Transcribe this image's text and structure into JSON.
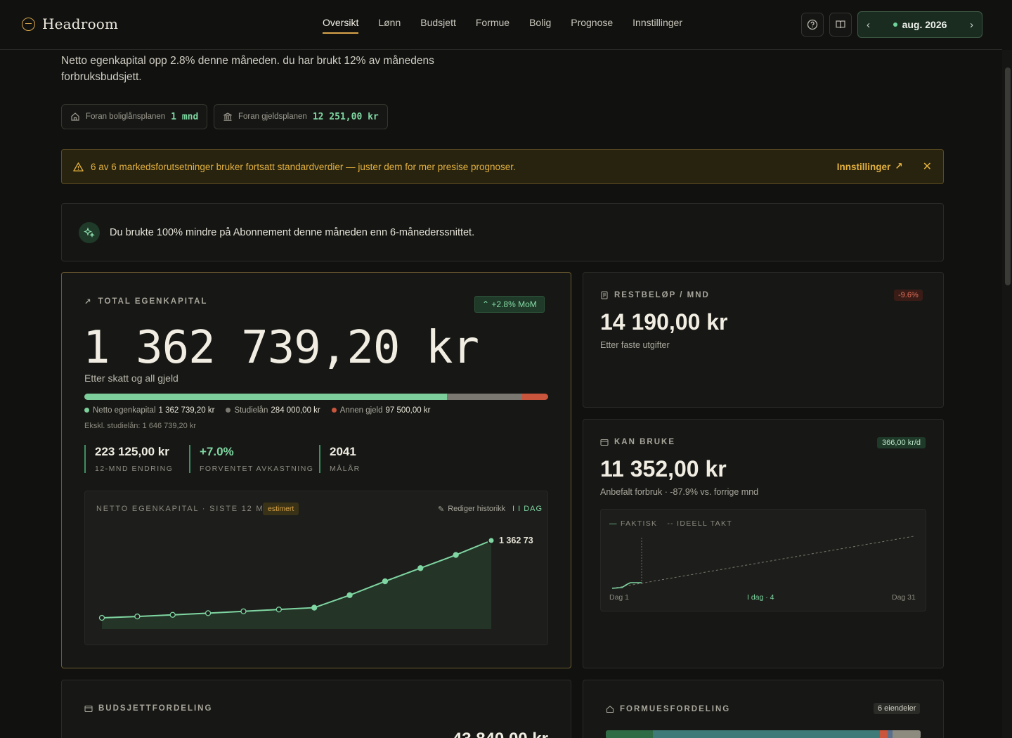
{
  "app": {
    "name": "Headroom"
  },
  "nav": {
    "items": [
      "Oversikt",
      "Lønn",
      "Budsjett",
      "Formue",
      "Bolig",
      "Prognose",
      "Innstillinger"
    ],
    "active": "Oversikt"
  },
  "month_picker": {
    "label": "aug. 2026"
  },
  "summary": {
    "text": "Netto egenkapital opp 2.8% denne måneden. du har brukt 12% av månedens forbruksbudsjett."
  },
  "chips": [
    {
      "label": "Foran boliglånsplanen",
      "value": "1 mnd",
      "icon": "home-icon"
    },
    {
      "label": "Foran gjeldsplanen",
      "value": "12 251,00 kr",
      "icon": "bank-icon"
    }
  ],
  "warning": {
    "message": "6 av 6 markedsforutsetninger bruker fortsatt standardverdier — juster dem for mer presise prognoser.",
    "link": "Innstillinger"
  },
  "insight": {
    "text": "Du brukte 100% mindre på Abonnement denne måneden enn 6-månederssnittet."
  },
  "equity": {
    "label": "TOTAL EGENKAPITAL",
    "badge": "+2.8% MoM",
    "value": "1 362 739,20 kr",
    "sub": "Etter skatt og all gjeld",
    "bar": [
      {
        "name": "Netto egenkapital",
        "value": "1 362 739,20 kr",
        "amount": 1362739.2,
        "color": "#7ccf9a"
      },
      {
        "name": "Studielån",
        "value": "284 000,00 kr",
        "amount": 284000,
        "color": "#7a7870"
      },
      {
        "name": "Annen gjeld",
        "value": "97 500,00 kr",
        "amount": 97500,
        "color": "#c9553d"
      }
    ],
    "excl": "Ekskl. studielån: 1 646 739,20 kr",
    "stats": [
      {
        "value": "223 125,00 kr",
        "label": "12-MND ENDRING"
      },
      {
        "value": "+7.0%",
        "label": "FORVENTET AVKASTNING"
      },
      {
        "value": "2041",
        "label": "MÅLÅR"
      }
    ],
    "chart_panel": {
      "title": "NETTO EGENKAPITAL · SISTE 12 MND",
      "tag": "estimert",
      "edit": "Rediger historikk",
      "range": "I DAG",
      "end_label": "1 362 73"
    }
  },
  "remaining": {
    "label": "RESTBELØP / MND",
    "badge": "-9.6%",
    "value": "14 190,00 kr",
    "sub": "Etter faste utgifter"
  },
  "spendable": {
    "label": "KAN BRUKE",
    "badge": "366,00 kr/d",
    "value": "11 352,00 kr",
    "sub": "Anbefalt forbruk  · -87.9% vs. forrige mnd",
    "chart": {
      "legend_actual": "FAKTISK",
      "legend_ideal": "IDEELL TAKT",
      "x_start": "Dag 1",
      "x_today": "I dag · 4",
      "x_end": "Dag 31"
    }
  },
  "budget": {
    "label": "BUDSJETTFORDELING",
    "value": "43 840,00 kr"
  },
  "wealth": {
    "label": "FORMUESFORDELING",
    "badge": "6 eiendeler",
    "segments": [
      {
        "fraction": 0.15,
        "color": "#2f6b45"
      },
      {
        "fraction": 0.72,
        "color": "#3d7a78"
      },
      {
        "fraction": 0.025,
        "color": "#c9553d"
      },
      {
        "fraction": 0.015,
        "color": "#5a6f8c"
      },
      {
        "fraction": 0.09,
        "color": "#8d8a80"
      }
    ]
  },
  "chart_data": {
    "type": "line",
    "title": "NETTO EGENKAPITAL · SISTE 12 MND",
    "x": [
      1,
      2,
      3,
      4,
      5,
      6,
      7,
      8,
      9,
      10,
      11,
      12
    ],
    "series": [
      {
        "values": [
          1139614,
          1143500,
          1148200,
          1153100,
          1158400,
          1163600,
          1168900,
          1205000,
          1245000,
          1283000,
          1321000,
          1362739
        ]
      }
    ]
  }
}
